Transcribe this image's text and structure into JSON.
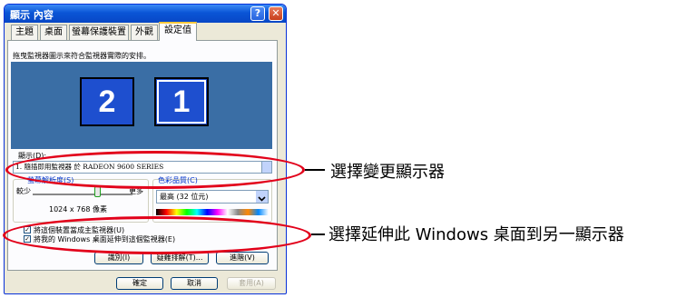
{
  "window": {
    "title": "顯示 內容",
    "help": "?",
    "close": "✕"
  },
  "tabs": [
    "主題",
    "桌面",
    "螢幕保護裝置",
    "外觀",
    "設定值"
  ],
  "instructions": "拖曳監視器圖示來符合監視器實際的安排。",
  "monitors": [
    "2",
    "1"
  ],
  "display": {
    "label": "顯示(D):",
    "value": "1. 隨插即用監視器 於 RADEON 9600 SERIES"
  },
  "resolution": {
    "label": "螢幕解析度(S)",
    "less": "較少",
    "more": "更多",
    "value": "1024 x 768 像素"
  },
  "color_quality": {
    "label": "色彩品質(C)",
    "value": "最高 (32 位元)"
  },
  "checkboxes": [
    {
      "label": "將這個裝置當成主監視器(U)",
      "checked": true
    },
    {
      "label": "將我的 Windows 桌面延伸到這個監視器(E)",
      "checked": true
    }
  ],
  "panel_buttons": {
    "identify": "識別(I)",
    "troubleshoot": "疑難排解(T)...",
    "advanced": "進階(V)"
  },
  "dialog_buttons": {
    "ok": "確定",
    "cancel": "取消",
    "apply": "套用(A)"
  },
  "callouts": {
    "change_display": "選擇變更顯示器",
    "extend_desktop": "選擇延伸此 Windows 桌面到另一顯示器"
  },
  "colors": {
    "highlight": "#e2001a",
    "titlebar": "#0a55d6",
    "monitor_bg": "#3a6ea5"
  }
}
